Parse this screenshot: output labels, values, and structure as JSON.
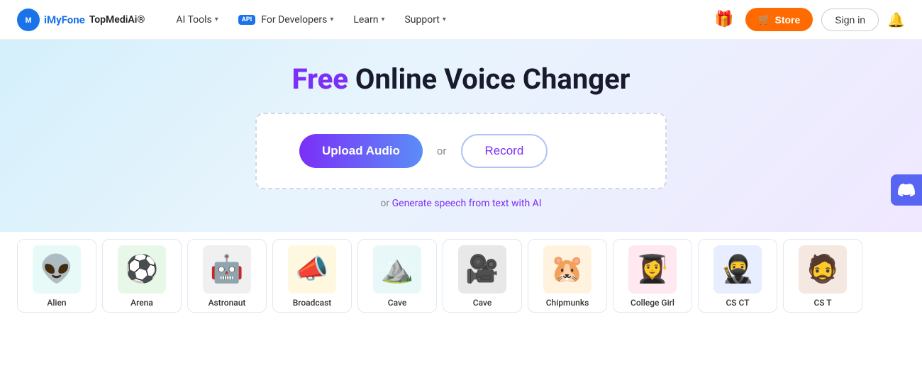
{
  "brand": {
    "badge_text": "M",
    "name": "iMyFone",
    "product": "TopMediAi®"
  },
  "nav": {
    "items": [
      {
        "label": "AI Tools",
        "has_dropdown": true
      },
      {
        "label": "For Developers",
        "has_dropdown": true,
        "has_api_badge": true
      },
      {
        "label": "Learn",
        "has_dropdown": true
      },
      {
        "label": "Support",
        "has_dropdown": true
      }
    ],
    "store_label": "Store",
    "signin_label": "Sign in"
  },
  "hero": {
    "title_free": "Free",
    "title_rest": " Online Voice Changer",
    "upload_label": "Upload Audio",
    "or_text": "or",
    "record_label": "Record",
    "generate_prefix": "or ",
    "generate_link_text": "Generate speech from text with AI"
  },
  "voice_cards": [
    {
      "id": "alien",
      "label": "Alien",
      "emoji": "👽",
      "icon_class": "icon-alien"
    },
    {
      "id": "arena",
      "label": "Arena",
      "emoji": "⚽",
      "icon_class": "icon-arena"
    },
    {
      "id": "astronaut",
      "label": "Astronaut",
      "emoji": "🤖",
      "icon_class": "icon-astronaut"
    },
    {
      "id": "broadcast",
      "label": "Broadcast",
      "emoji": "📣",
      "icon_class": "icon-broadcast"
    },
    {
      "id": "cave1",
      "label": "Cave",
      "emoji": "⛰️",
      "icon_class": "icon-cave1"
    },
    {
      "id": "cave2",
      "label": "Cave",
      "emoji": "🎥",
      "icon_class": "icon-cave2"
    },
    {
      "id": "chipmunks",
      "label": "Chipmunks",
      "emoji": "🐹",
      "icon_class": "icon-chipmunks"
    },
    {
      "id": "college-girl",
      "label": "College Girl",
      "emoji": "👩‍🎓",
      "icon_class": "icon-college"
    },
    {
      "id": "csct",
      "label": "CS CT",
      "emoji": "🥷",
      "icon_class": "icon-csct"
    },
    {
      "id": "cst",
      "label": "CS T",
      "emoji": "🧔",
      "icon_class": "icon-cst"
    }
  ],
  "discord": {
    "label": "Discord",
    "emoji": "💬"
  }
}
